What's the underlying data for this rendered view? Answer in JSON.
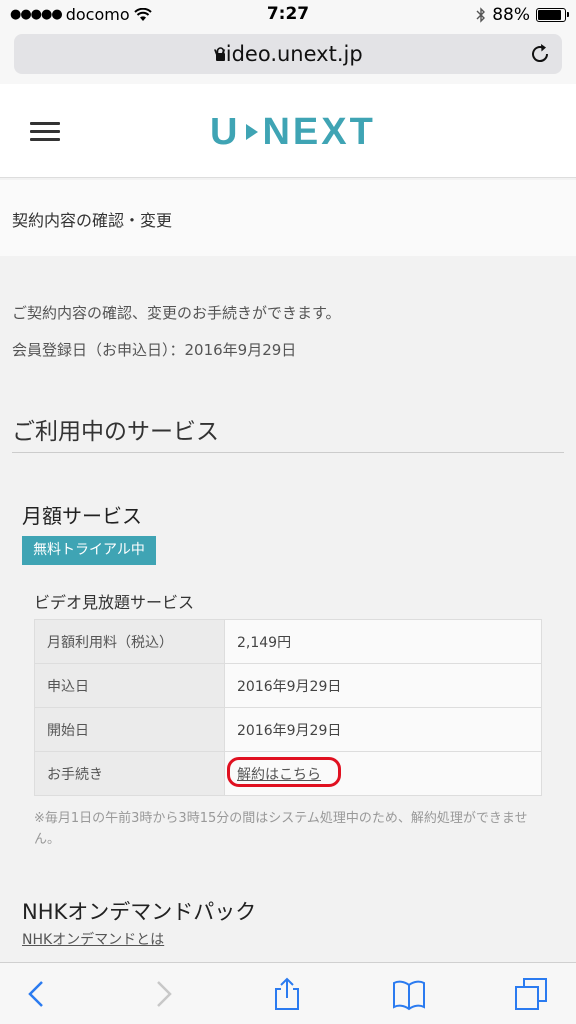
{
  "status_bar": {
    "signal": "●●●●●",
    "carrier": "docomo",
    "time": "7:27",
    "battery": "88%",
    "battery_level": 0.88
  },
  "browser": {
    "url": "video.unext.jp"
  },
  "header": {
    "logo_left": "U",
    "logo_right": "NEXT",
    "accent": "#3fa4b4"
  },
  "page": {
    "title": "契約内容の確認・変更",
    "intro": "ご契約内容の確認、変更のお手続きができます。",
    "reg_date": "会員登録日（お申込日）：2016年9月29日",
    "section_title": "ご利用中のサービス"
  },
  "monthly": {
    "title": "月額サービス",
    "badge": "無料トライアル中",
    "service_name": "ビデオ見放題サービス",
    "rows": [
      {
        "key": "月額利用料（税込）",
        "value": "2,149円"
      },
      {
        "key": "申込日",
        "value": "2016年9月29日"
      },
      {
        "key": "開始日",
        "value": "2016年9月29日"
      },
      {
        "key": "お手続き",
        "value": "解約はこちら"
      }
    ],
    "note": "※毎月1日の午前3時から3時15分の間はシステム処理中のため、解約処理ができません。"
  },
  "nhk": {
    "title": "NHKオンデマンドパック",
    "link": "NHKオンデマンドとは"
  },
  "toolbar": {
    "icons": [
      "back-icon",
      "forward-icon",
      "share-icon",
      "bookmarks-icon",
      "tabs-icon"
    ]
  }
}
